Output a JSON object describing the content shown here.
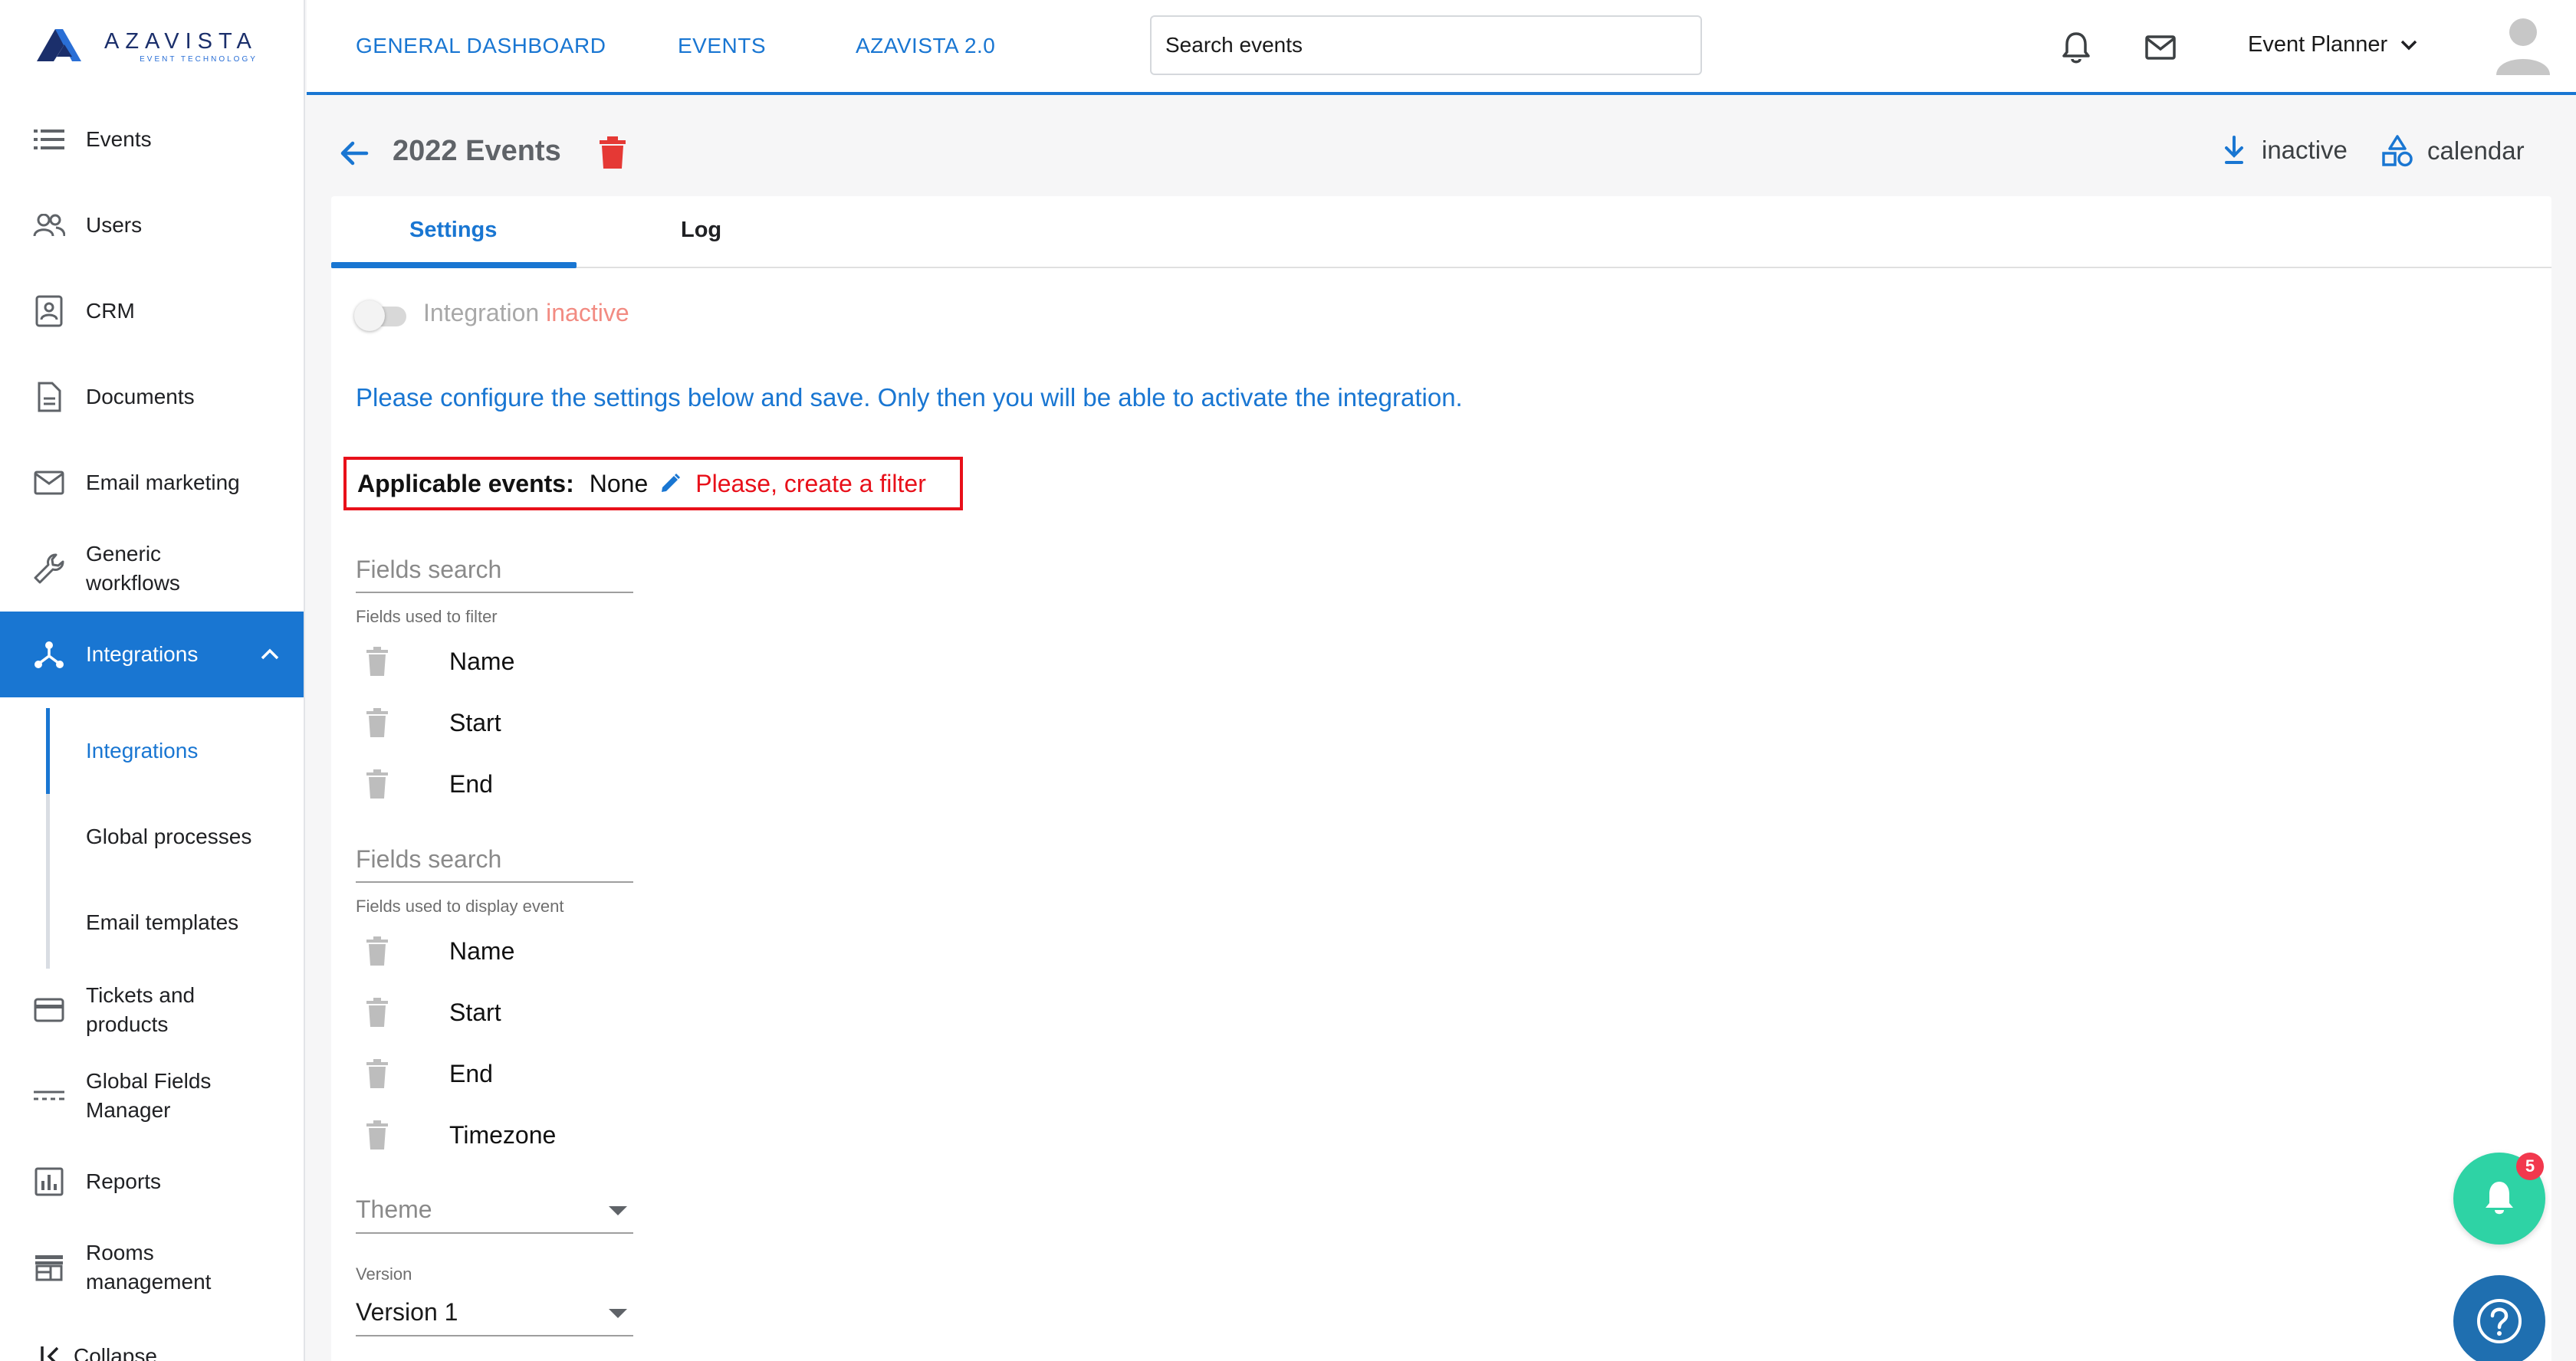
{
  "brand": {
    "name": "AZAVISTA",
    "tagline": "EVENT TECHNOLOGY"
  },
  "topbar": {
    "links": [
      "GENERAL DASHBOARD",
      "EVENTS",
      "AZAVISTA 2.0"
    ],
    "search_placeholder": "Search events",
    "user_name": "Event Planner"
  },
  "sidebar": {
    "items": [
      {
        "label": "Events",
        "icon": "list-icon"
      },
      {
        "label": "Users",
        "icon": "users-icon"
      },
      {
        "label": "CRM",
        "icon": "contacts-icon"
      },
      {
        "label": "Documents",
        "icon": "document-icon"
      },
      {
        "label": "Email marketing",
        "icon": "mail-icon"
      },
      {
        "label": "Generic\nworkflows",
        "icon": "wrench-icon"
      },
      {
        "label": "Integrations",
        "icon": "integrations-icon",
        "active": true
      }
    ],
    "sub_items": [
      "Integrations",
      "Global processes",
      "Email templates"
    ],
    "items_after": [
      {
        "label": "Tickets and\nproducts",
        "icon": "card-icon"
      },
      {
        "label": "Global Fields\nManager",
        "icon": "fields-icon"
      },
      {
        "label": "Reports",
        "icon": "reports-icon"
      },
      {
        "label": "Rooms\nmanagement",
        "icon": "store-icon"
      }
    ],
    "collapse_label": "Collapse"
  },
  "page": {
    "title": "2022 Events",
    "actions": [
      "inactive",
      "calendar"
    ]
  },
  "tabs": [
    "Settings",
    "Log"
  ],
  "integration": {
    "label": "Integration",
    "state": "inactive",
    "enabled": false,
    "info": "Please configure the settings below and save. Only then you will be able to activate the integration."
  },
  "applicable_events": {
    "label": "Applicable events:",
    "value": "None",
    "warning": "Please, create a filter"
  },
  "filter_fields": {
    "search_placeholder": "Fields search",
    "caption": "Fields used to filter",
    "items": [
      "Name",
      "Start",
      "End"
    ]
  },
  "display_fields": {
    "search_placeholder": "Fields search",
    "caption": "Fields used to display event",
    "items": [
      "Name",
      "Start",
      "End",
      "Timezone"
    ]
  },
  "theme": {
    "placeholder": "Theme"
  },
  "version": {
    "caption": "Version",
    "value": "Version 1"
  },
  "notifications": {
    "count": "5"
  },
  "colors": {
    "accent": "#1976d2",
    "danger": "#e8101a",
    "success": "#2ed3a5"
  }
}
